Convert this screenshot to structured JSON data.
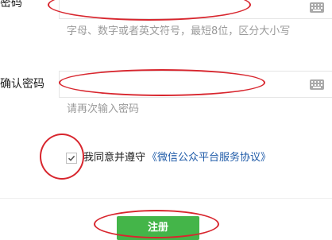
{
  "password": {
    "label": "密码",
    "value": "",
    "hint": "字母、数字或者英文符号，最短8位，区分大小写",
    "keyboard_icon": "keyboard-icon"
  },
  "confirm_password": {
    "label": "确认密码",
    "value": "",
    "hint": "请再次输入密码",
    "keyboard_icon": "keyboard-icon"
  },
  "agreement": {
    "checked": true,
    "text": "我同意并遵守",
    "link": "《微信公众平台服务协议》"
  },
  "register_button": {
    "label": "注册",
    "color": "#44b549"
  },
  "annotation_color": "#d8262e"
}
